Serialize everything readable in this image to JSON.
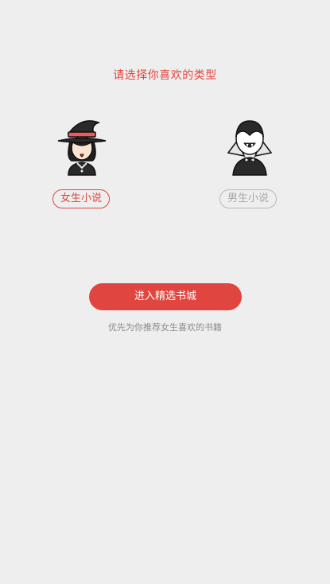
{
  "header": {
    "title": "请选择你喜欢的类型"
  },
  "options": [
    {
      "label": "女生小说",
      "selected": true,
      "icon": "female-witch-avatar-icon"
    },
    {
      "label": "男生小说",
      "selected": false,
      "icon": "male-vampire-avatar-icon"
    }
  ],
  "actions": {
    "enter_label": "进入精选书城",
    "hint": "优先为你推荐女生喜欢的书籍"
  },
  "colors": {
    "accent": "#e0463f",
    "inactive": "#a8a8a8",
    "background": "#eeeeee"
  }
}
